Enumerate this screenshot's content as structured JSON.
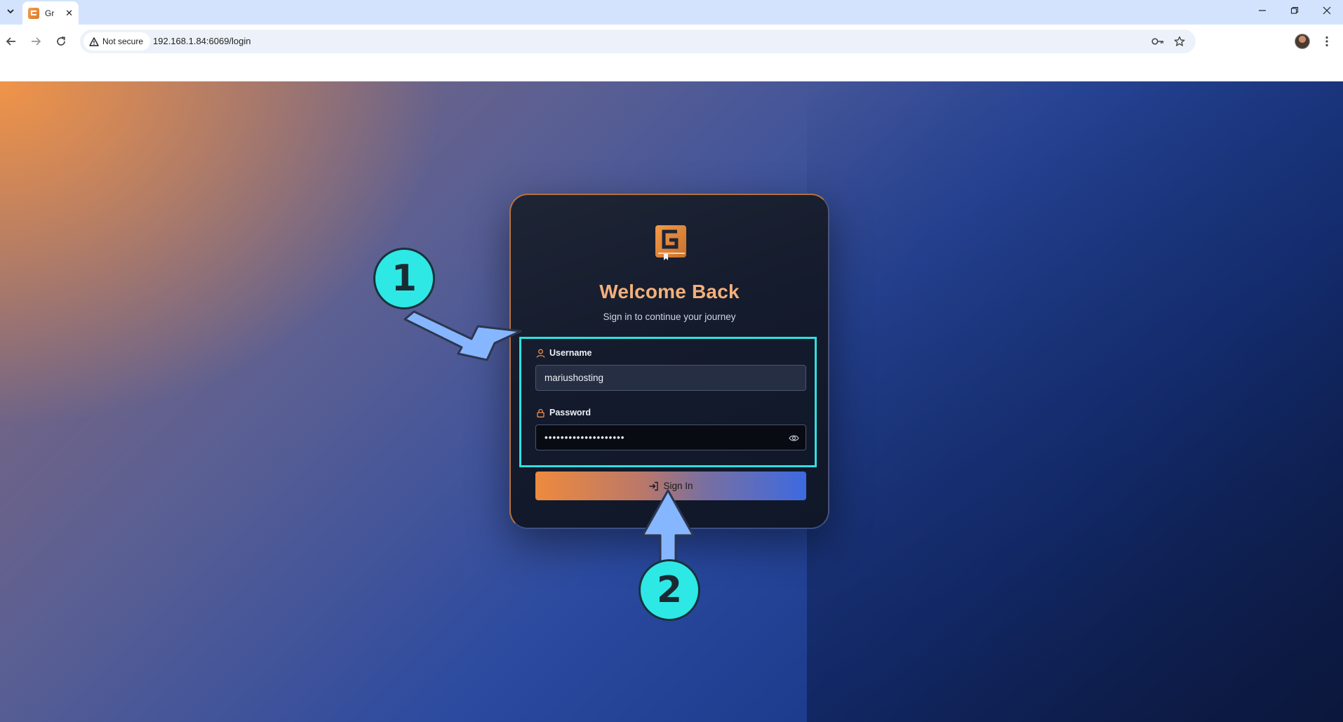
{
  "browser": {
    "tab_title": "Gr",
    "security_label": "Not secure",
    "url": "192.168.1.84:6069/login",
    "tab_close_glyph": "✕"
  },
  "login": {
    "title": "Welcome Back",
    "subtitle": "Sign in to continue your journey",
    "username_label": "Username",
    "username_value": "mariushosting",
    "password_label": "Password",
    "password_value": "••••••••••••••••••••",
    "signin_label": "Sign In"
  },
  "annotations": {
    "step1": "1",
    "step2": "2"
  },
  "colors": {
    "accent_orange": "#f4b07b",
    "highlight_cyan": "#2ee0df",
    "button_gradient_start": "#ee8a3e",
    "button_gradient_end": "#3d6ae0"
  },
  "icons": {
    "tab_search": "chevron-down-icon",
    "back": "arrow-left-icon",
    "forward": "arrow-right-icon",
    "reload": "reload-icon",
    "security": "warning-triangle-icon",
    "password_manager": "key-icon",
    "bookmark": "star-icon",
    "menu": "kebab-menu-icon",
    "username": "user-icon",
    "password": "lock-icon",
    "reveal": "eye-icon",
    "signin": "login-arrow-icon"
  }
}
